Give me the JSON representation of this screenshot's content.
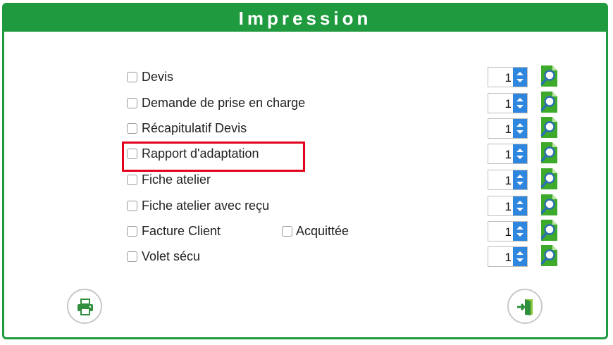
{
  "dialog": {
    "title": "Impression"
  },
  "rows": [
    {
      "label": "Devis",
      "copies": "1"
    },
    {
      "label": "Demande de prise en charge",
      "copies": "1"
    },
    {
      "label": "Récapitulatif Devis",
      "copies": "1"
    },
    {
      "label": "Rapport d'adaptation",
      "copies": "1",
      "highlighted": true
    },
    {
      "label": "Fiche atelier",
      "copies": "1"
    },
    {
      "label": "Fiche atelier avec reçu",
      "copies": "1"
    },
    {
      "label": "Facture Client",
      "copies": "1",
      "extra_label": "Acquittée"
    },
    {
      "label": "Volet sécu",
      "copies": "1"
    }
  ],
  "footer": {
    "print_icon": "printer-icon",
    "exit_icon": "exit-door-icon"
  },
  "colors": {
    "header": "#1f9a3f",
    "spinner": "#2e86de",
    "highlight": "#e3001b"
  }
}
